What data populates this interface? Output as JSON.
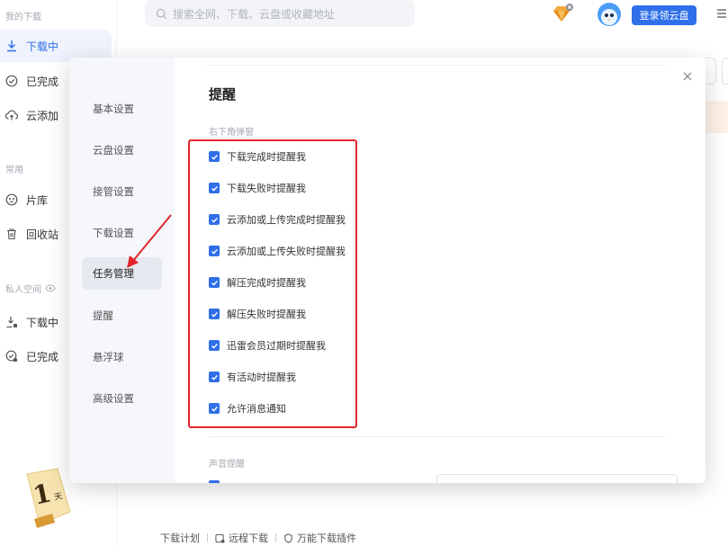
{
  "sidebar": {
    "section_downloads": "我的下载",
    "items": [
      {
        "label": "下载中"
      },
      {
        "label": "已完成"
      },
      {
        "label": "云添加"
      }
    ],
    "section_common": "常用",
    "common_items": [
      {
        "label": "片库"
      },
      {
        "label": "回收站"
      }
    ],
    "section_private": "私人空间",
    "private_items": [
      {
        "label": "下载中"
      },
      {
        "label": "已完成"
      }
    ]
  },
  "topbar": {
    "search_placeholder": "搜索全网、下载、云盘或收藏地址",
    "login_label": "登录领云盘"
  },
  "dialog": {
    "nav": [
      {
        "label": "基本设置"
      },
      {
        "label": "云盘设置"
      },
      {
        "label": "接管设置"
      },
      {
        "label": "下载设置"
      },
      {
        "label": "任务管理"
      },
      {
        "label": "提醒"
      },
      {
        "label": "悬浮球"
      },
      {
        "label": "高级设置"
      }
    ],
    "active_nav": "任务管理",
    "title": "提醒",
    "sub_popup": "右下角弹窗",
    "options": [
      {
        "label": "下载完成时提醒我",
        "checked": true
      },
      {
        "label": "下载失败时提醒我",
        "checked": true
      },
      {
        "label": "云添加或上传完成时提醒我",
        "checked": true
      },
      {
        "label": "云添加或上传失败时提醒我",
        "checked": true
      },
      {
        "label": "解压完成时提醒我",
        "checked": true
      },
      {
        "label": "解压失败时提醒我",
        "checked": true
      },
      {
        "label": "迅雷会员过期时提醒我",
        "checked": true
      },
      {
        "label": "有活动时提醒我",
        "checked": true
      },
      {
        "label": "允许消息通知",
        "checked": true
      }
    ],
    "sub_sound": "声音提醒",
    "close_glyph": "×"
  },
  "bottom": {
    "plan": "下载计划",
    "remote": "远程下载",
    "plugin": "万能下载插件"
  },
  "badge": {
    "number": "1",
    "unit": "天"
  },
  "colors": {
    "accent": "#2f6fe8",
    "highlight": "#e4262c"
  }
}
